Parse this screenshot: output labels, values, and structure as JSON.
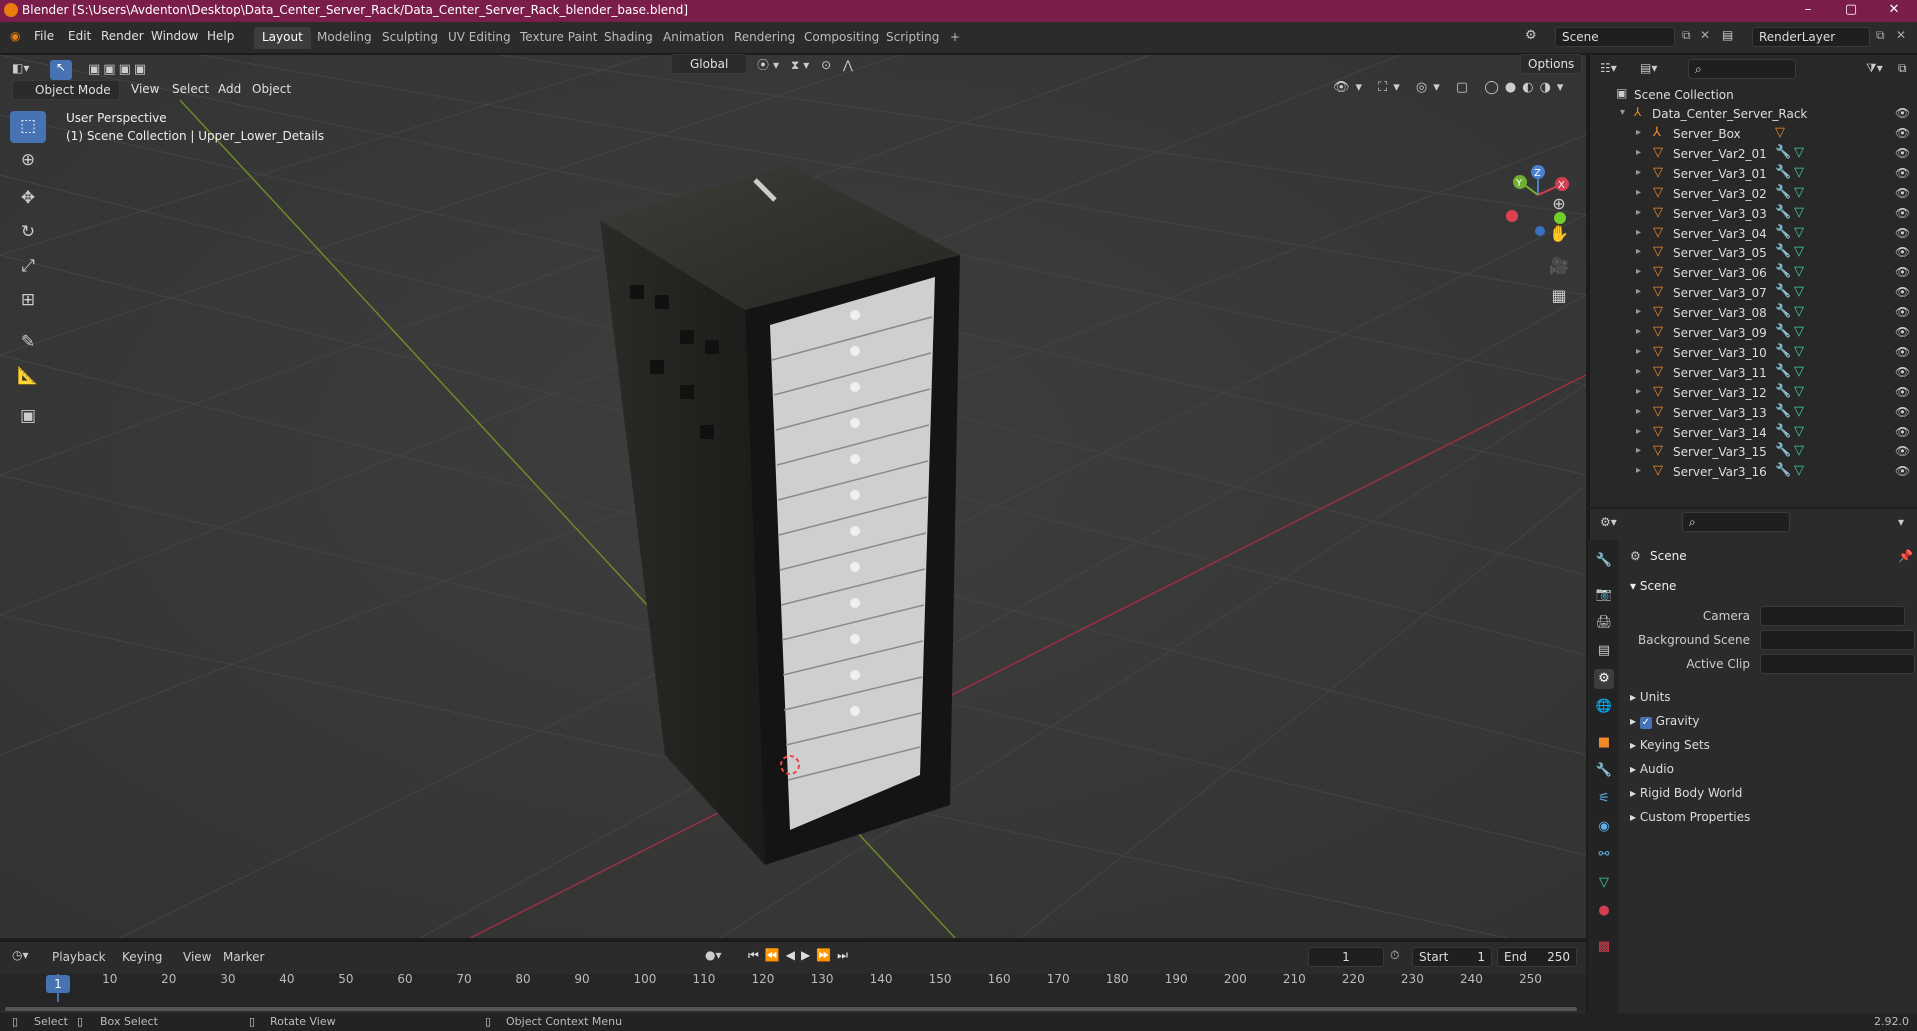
{
  "titlebar": {
    "title": "Blender [S:\\Users\\Avdenton\\Desktop\\Data_Center_Server_Rack/Data_Center_Server_Rack_blender_base.blend]",
    "minimize": "–",
    "maximize": "▢",
    "close": "✕"
  },
  "menubar": {
    "menus": [
      "File",
      "Edit",
      "Render",
      "Window",
      "Help"
    ],
    "workspaces": [
      "Layout",
      "Modeling",
      "Sculpting",
      "UV Editing",
      "Texture Paint",
      "Shading",
      "Animation",
      "Rendering",
      "Compositing",
      "Scripting"
    ],
    "add_workspace": "+",
    "scene_name": "Scene",
    "render_layer": "RenderLayer"
  },
  "viewport_header": {
    "mode": "Object Mode",
    "menus": [
      "View",
      "Select",
      "Add",
      "Object"
    ],
    "orientation": "Global",
    "options": "Options"
  },
  "viewport": {
    "perspective": "User Perspective",
    "collection_info": "(1) Scene Collection | Upper_Lower_Details",
    "gizmo": {
      "x": "X",
      "y": "Y",
      "z": "Z"
    }
  },
  "outliner": {
    "root": "Scene Collection",
    "collection": "Data_Center_Server_Rack",
    "items": [
      {
        "name": "Server_Box"
      },
      {
        "name": "Server_Var2_01"
      },
      {
        "name": "Server_Var3_01"
      },
      {
        "name": "Server_Var3_02"
      },
      {
        "name": "Server_Var3_03"
      },
      {
        "name": "Server_Var3_04"
      },
      {
        "name": "Server_Var3_05"
      },
      {
        "name": "Server_Var3_06"
      },
      {
        "name": "Server_Var3_07"
      },
      {
        "name": "Server_Var3_08"
      },
      {
        "name": "Server_Var3_09"
      },
      {
        "name": "Server_Var3_10"
      },
      {
        "name": "Server_Var3_11"
      },
      {
        "name": "Server_Var3_12"
      },
      {
        "name": "Server_Var3_13"
      },
      {
        "name": "Server_Var3_14"
      },
      {
        "name": "Server_Var3_15"
      },
      {
        "name": "Server_Var3_16"
      }
    ]
  },
  "properties": {
    "context": "Scene",
    "panel": "Scene",
    "fields": {
      "camera": "Camera",
      "background_scene": "Background Scene",
      "active_clip": "Active Clip"
    },
    "sections": [
      "Units",
      "Gravity",
      "Keying Sets",
      "Audio",
      "Rigid Body World",
      "Custom Properties"
    ],
    "gravity_enabled": true
  },
  "timeline": {
    "menus": [
      "Playback",
      "Keying",
      "View",
      "Marker"
    ],
    "current_frame": "1",
    "start_label": "Start",
    "start": "1",
    "end_label": "End",
    "end": "250",
    "ticks": [
      "1",
      "10",
      "20",
      "30",
      "40",
      "50",
      "60",
      "70",
      "80",
      "90",
      "100",
      "110",
      "120",
      "130",
      "140",
      "150",
      "160",
      "170",
      "180",
      "190",
      "200",
      "210",
      "220",
      "230",
      "240",
      "250"
    ]
  },
  "statusbar": {
    "select": "Select",
    "box_select": "Box Select",
    "rotate": "Rotate View",
    "context_menu": "Object Context Menu",
    "version": "2.92.0"
  }
}
